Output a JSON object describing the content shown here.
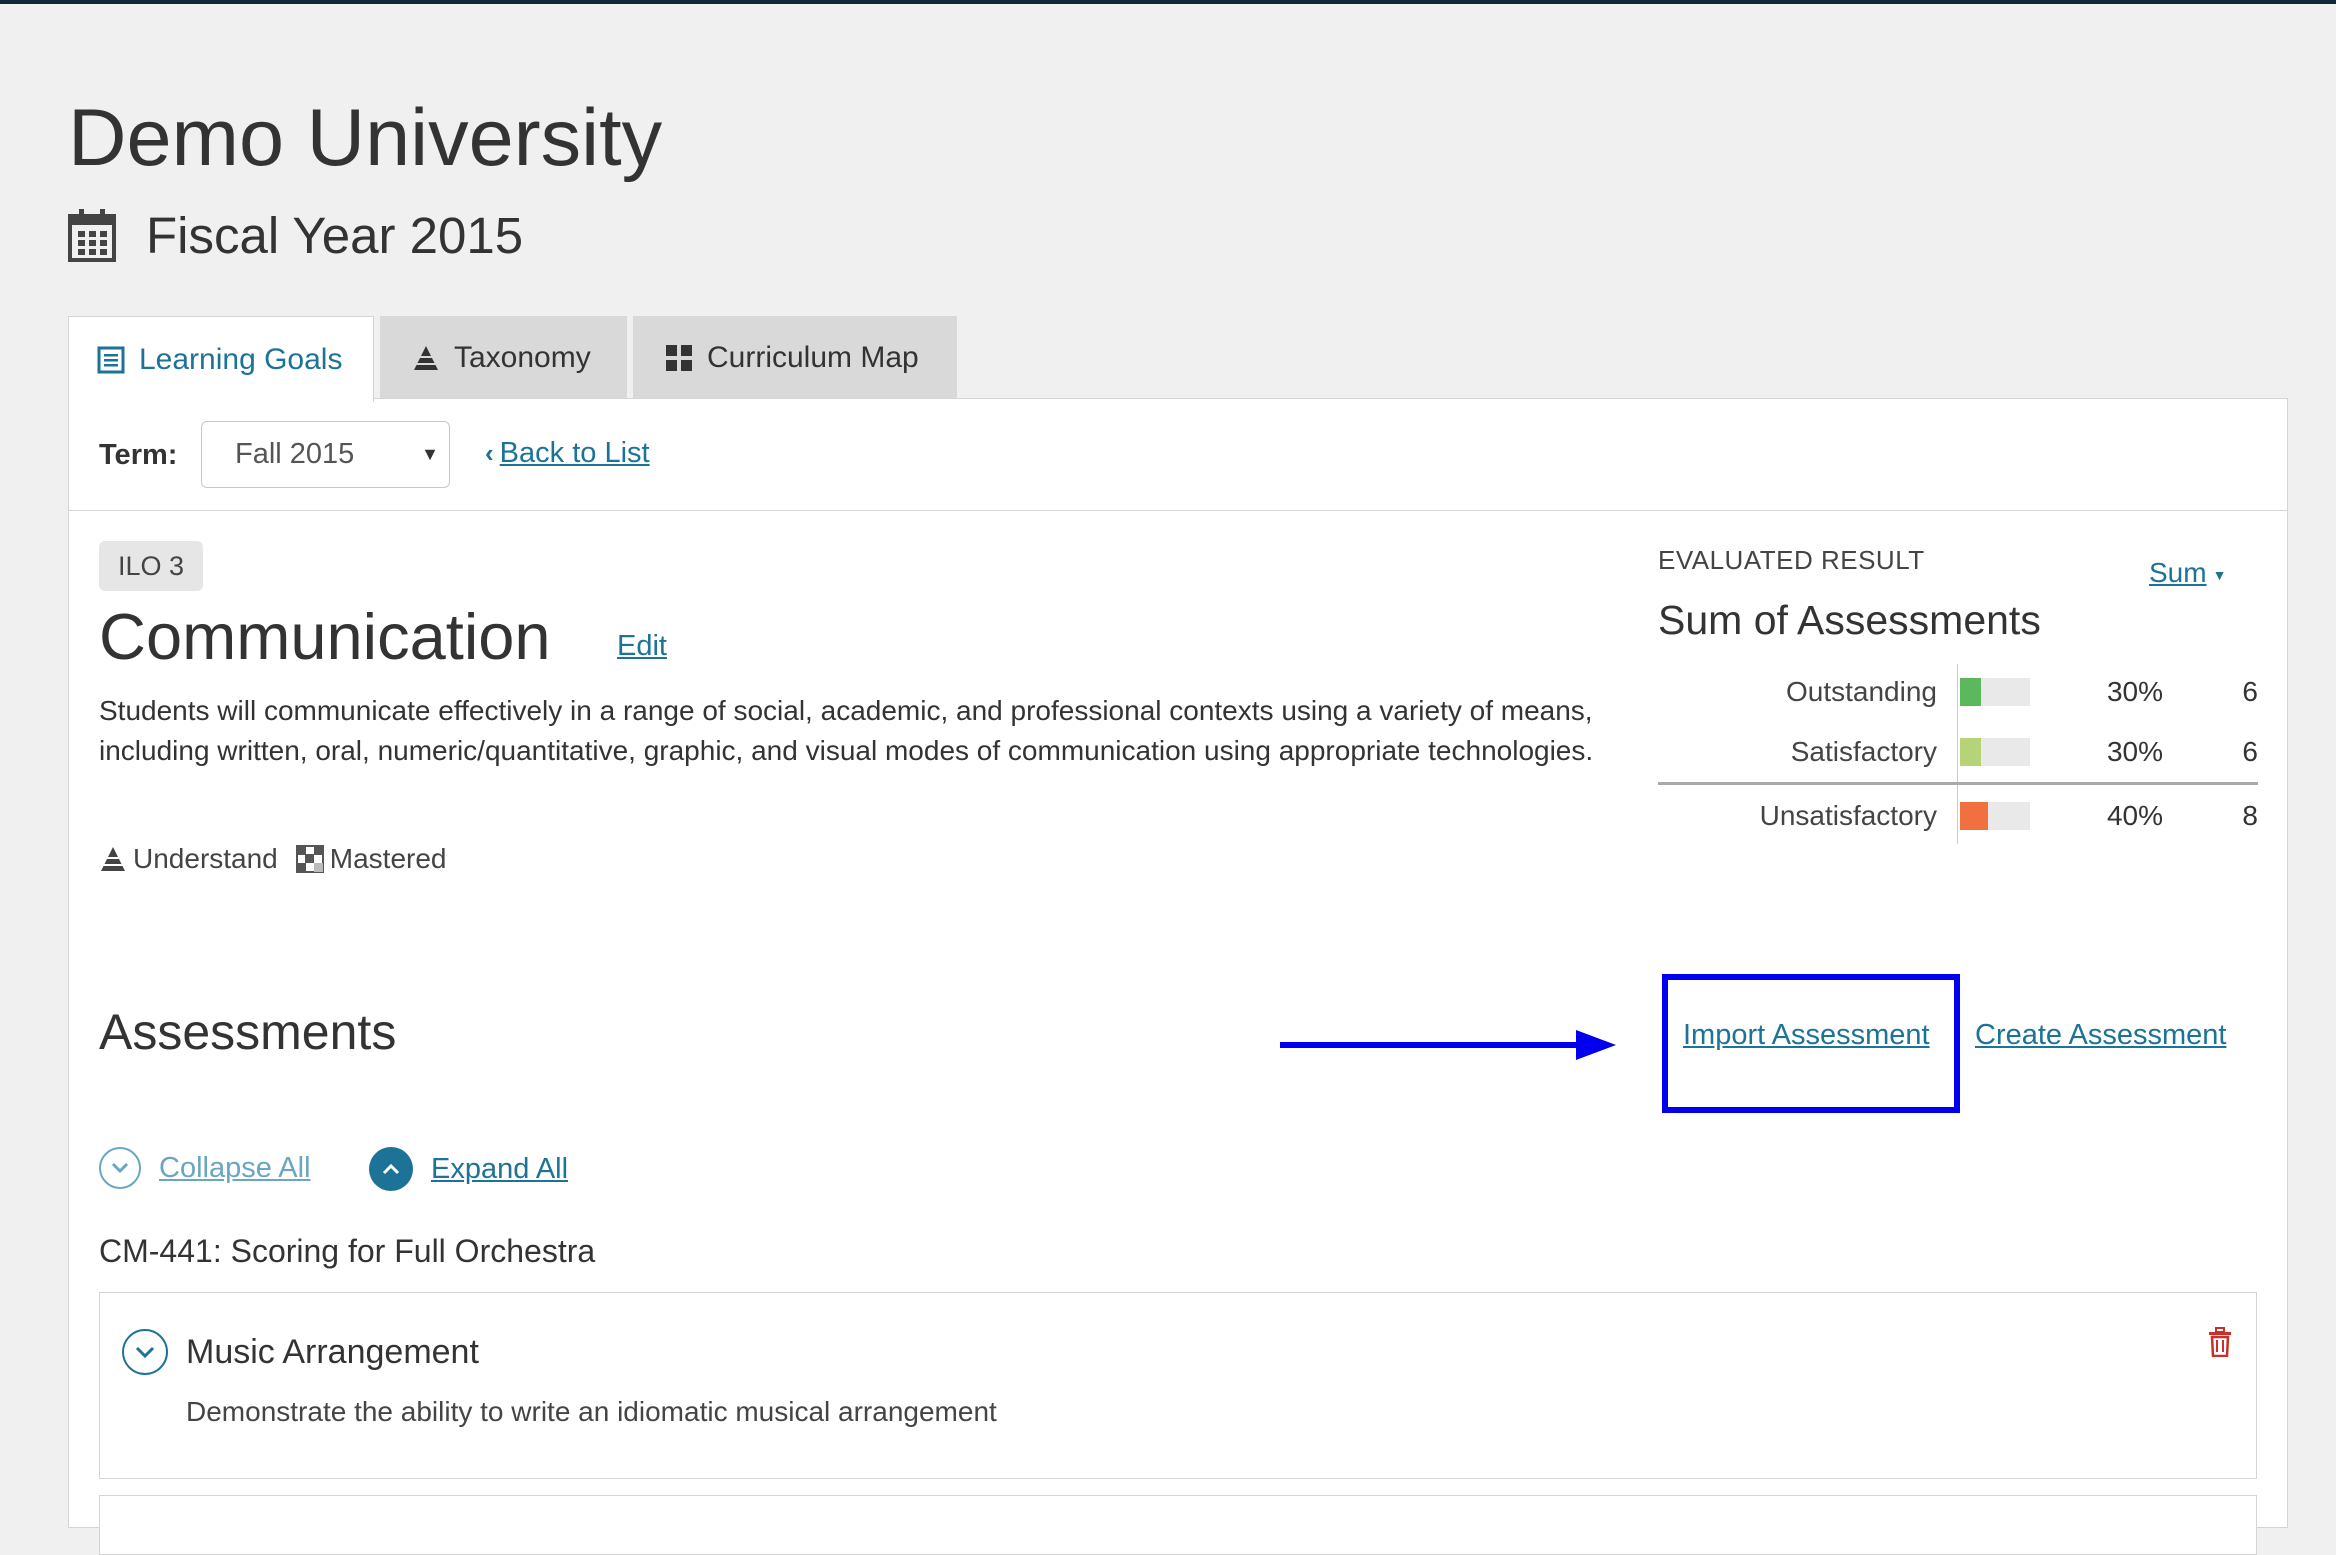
{
  "header": {
    "university": "Demo University",
    "fiscal_year": "Fiscal Year 2015"
  },
  "tabs": [
    {
      "label": "Learning Goals",
      "icon": "list-icon",
      "active": true
    },
    {
      "label": "Taxonomy",
      "icon": "pyramid-icon",
      "active": false
    },
    {
      "label": "Curriculum Map",
      "icon": "grid-icon",
      "active": false
    }
  ],
  "toolbar": {
    "term_label": "Term:",
    "term_value": "Fall 2015",
    "back_label": "Back to List"
  },
  "goal": {
    "badge": "ILO 3",
    "title": "Communication",
    "edit_label": "Edit",
    "description": "Students will communicate effectively in a range of social, academic, and professional contexts using a variety of means, including written, oral, numeric/quantitative, graphic, and visual modes of communication using appropriate technologies.",
    "taxonomy_tag": "Understand",
    "mastery_tag": "Mastered"
  },
  "evaluation": {
    "label": "EVALUATED RESULT",
    "aggregate_link": "Sum",
    "title": "Sum of Assessments",
    "results": [
      {
        "label": "Outstanding",
        "percent": "30%",
        "count": "6",
        "fill": 0.3,
        "color": "#5cb85c"
      },
      {
        "label": "Satisfactory",
        "percent": "30%",
        "count": "6",
        "fill": 0.3,
        "color": "#b5d47a"
      },
      {
        "label": "Unsatisfactory",
        "percent": "40%",
        "count": "8",
        "fill": 0.4,
        "color": "#f0703f"
      }
    ]
  },
  "assessments": {
    "title": "Assessments",
    "import_label": "Import Assessment",
    "create_label": "Create Assessment",
    "collapse_all": "Collapse All",
    "expand_all": "Expand All",
    "course": "CM-441: Scoring for Full Orchestra",
    "items": [
      {
        "title": "Music Arrangement",
        "description": "Demonstrate the ability to write an idiomatic musical arrangement"
      }
    ]
  },
  "colors": {
    "accent": "#1c7397",
    "highlight": "#0000ee",
    "danger": "#c9302c"
  }
}
